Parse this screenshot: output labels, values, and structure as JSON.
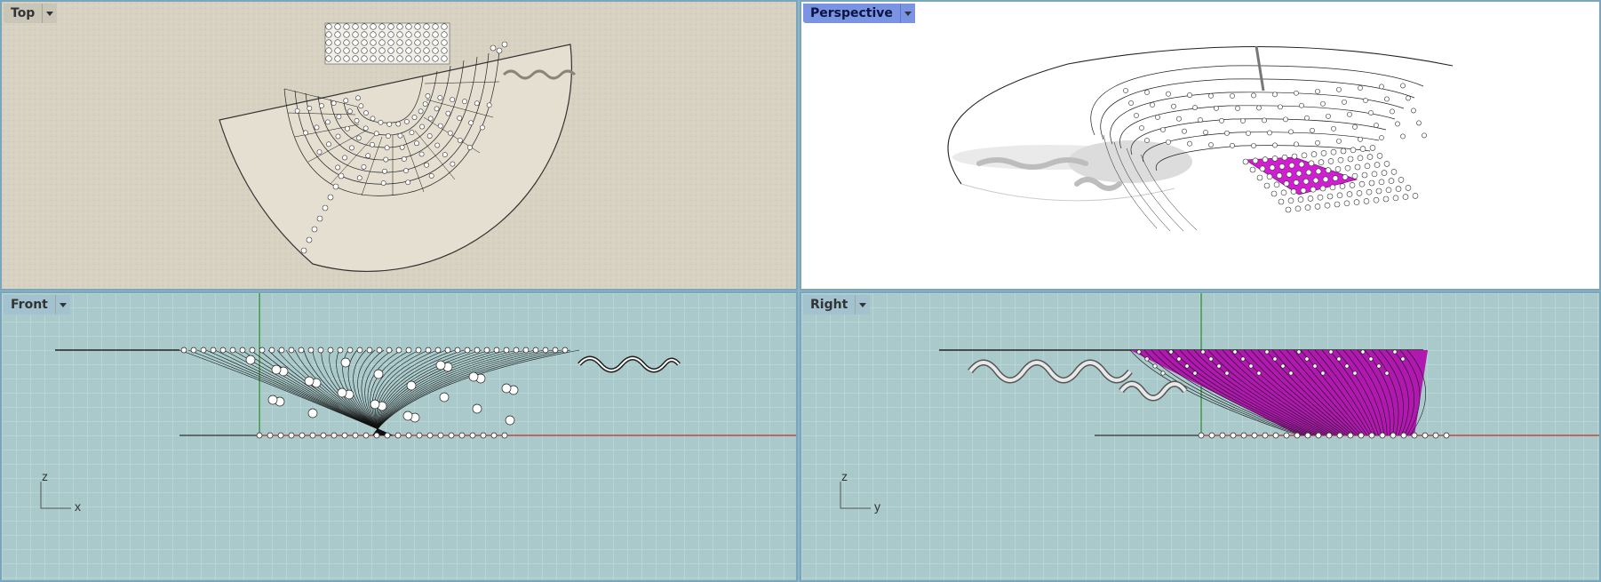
{
  "viewports": [
    {
      "name": "Top",
      "active": false
    },
    {
      "name": "Perspective",
      "active": true
    },
    {
      "name": "Front",
      "active": false
    },
    {
      "name": "Right",
      "active": false
    }
  ],
  "front_axes": {
    "vertical": "z",
    "horizontal": "x"
  },
  "right_axes": {
    "vertical": "z",
    "horizontal": "y"
  },
  "colors": {
    "grid_bg": "#a9c9ca",
    "grid_line": "#c6dedf",
    "selection": "#d21ed2",
    "top_bg": "#d8d2c3"
  },
  "icons": [
    "dropdown-caret-icon",
    "axis-gizmo-icon"
  ]
}
